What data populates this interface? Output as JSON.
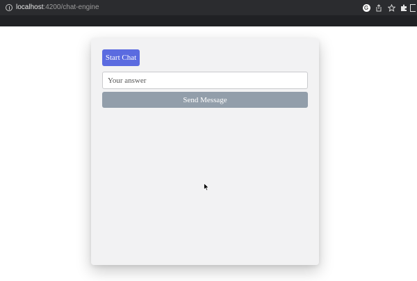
{
  "browser": {
    "url_host": "localhost",
    "url_path": ":4200/chat-engine",
    "icons": [
      "info-icon",
      "google-icon",
      "share-icon",
      "star-icon",
      "extensions-icon",
      "side-panel-icon"
    ],
    "google_letter": "G"
  },
  "chat": {
    "start_label": "Start Chat",
    "input_placeholder": "Your answer",
    "input_value": "",
    "send_label": "Send Message"
  },
  "colors": {
    "accent": "#5b6be0",
    "send_disabled": "#929eaa",
    "card_bg": "#f2f2f3",
    "browser_bar": "#2b2c2f"
  }
}
